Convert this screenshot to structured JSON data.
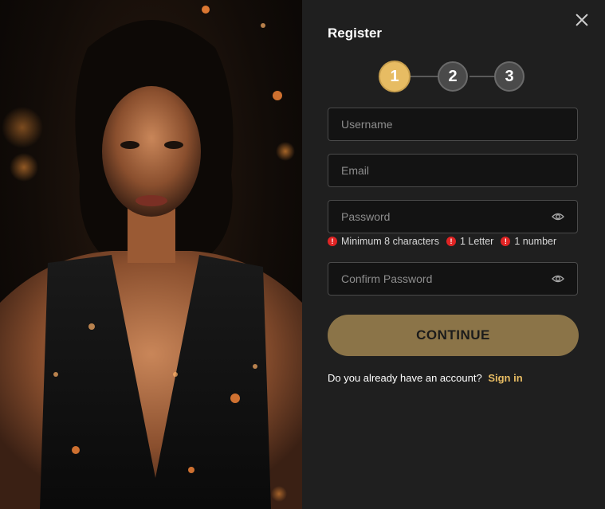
{
  "hero": {
    "image": "woman in black sequined dress portrait",
    "alt": "Promotional portrait"
  },
  "close": {
    "icon": "close-icon"
  },
  "register": {
    "title": "Register",
    "steps": [
      "1",
      "2",
      "3"
    ],
    "active_step": 1,
    "fields": {
      "username": {
        "placeholder": "Username",
        "value": ""
      },
      "email": {
        "placeholder": "Email",
        "value": ""
      },
      "password": {
        "placeholder": "Password",
        "value": ""
      },
      "confirm_password": {
        "placeholder": "Confirm Password",
        "value": ""
      }
    },
    "password_rules": [
      "Minimum 8 characters",
      "1 Letter",
      "1 number"
    ],
    "continue_label": "CONTINUE",
    "account_prompt": "Do you already have an account?",
    "sign_in_label": "Sign in"
  },
  "colors": {
    "accent": "#e7bc63",
    "button": "#8b7448",
    "panel": "#1f1f1f",
    "error": "#e02424"
  }
}
